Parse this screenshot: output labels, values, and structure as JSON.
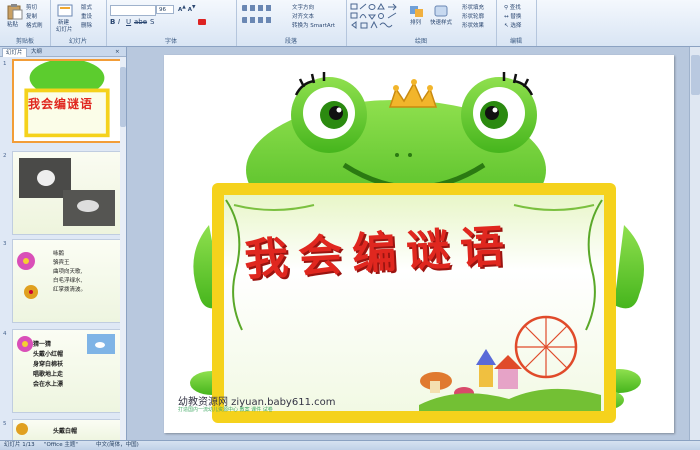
{
  "ribbon": {
    "groups": [
      {
        "label": "剪贴板"
      },
      {
        "label": "幻灯片"
      },
      {
        "label": "字体"
      },
      {
        "label": "段落"
      },
      {
        "label": "绘图"
      },
      {
        "label": "编辑"
      }
    ],
    "clipboard": {
      "paste": "粘贴",
      "cut": "剪切",
      "copy": "复制",
      "format_painter": "格式刷"
    },
    "slides": {
      "new_slide": "新建",
      "new_slide2": "幻灯片",
      "layout": "版式",
      "reset": "重设",
      "delete": "删除"
    },
    "font": {
      "name": "",
      "size": "96"
    },
    "paragraph": {
      "text_direction": "文字方向",
      "align_text": "对齐文本",
      "smartart": "转换为 SmartArt"
    },
    "drawing": {
      "arrange": "排列",
      "quick_styles": "快速样式",
      "fill": "形状填充",
      "outline": "形状轮廓",
      "effects": "形状效果"
    },
    "editing": {
      "find": "查找",
      "replace": "替换",
      "select": "选择"
    }
  },
  "panel": {
    "tabs": [
      "幻灯片",
      "大纲"
    ],
    "slide_numbers": [
      "1",
      "2",
      "3",
      "4",
      "5"
    ],
    "thumb1_title": "我会编谜语",
    "thumb3_lines": [
      "咏鹅",
      "骆宾王",
      "曲项向天歌,",
      "白毛浮绿水,",
      "红掌拨清波。"
    ],
    "thumb4_lines": [
      "猜一猜",
      "头戴小红帽",
      "身穿白棉袄",
      "唱歌地上走",
      "会在水上漂"
    ],
    "thumb5_lines": [
      "头戴白帽"
    ]
  },
  "slide": {
    "title": "我会编谜语",
    "watermark": "幼教资源网 ziyuan.baby611.com",
    "watermark_sub": "打造国内一流幼儿资源中心 教案 课件 试卷"
  },
  "status": {
    "slide_count": "幻灯片 1/13",
    "theme": "\"Office 主题\"",
    "language": "中文(简体，中国)"
  },
  "colors": {
    "frog_green": "#5ccc2e",
    "frog_dark": "#3ea418",
    "frame_yellow": "#f5d21c",
    "title_red": "#e0271f",
    "selected_thumb": "#f29d38"
  }
}
